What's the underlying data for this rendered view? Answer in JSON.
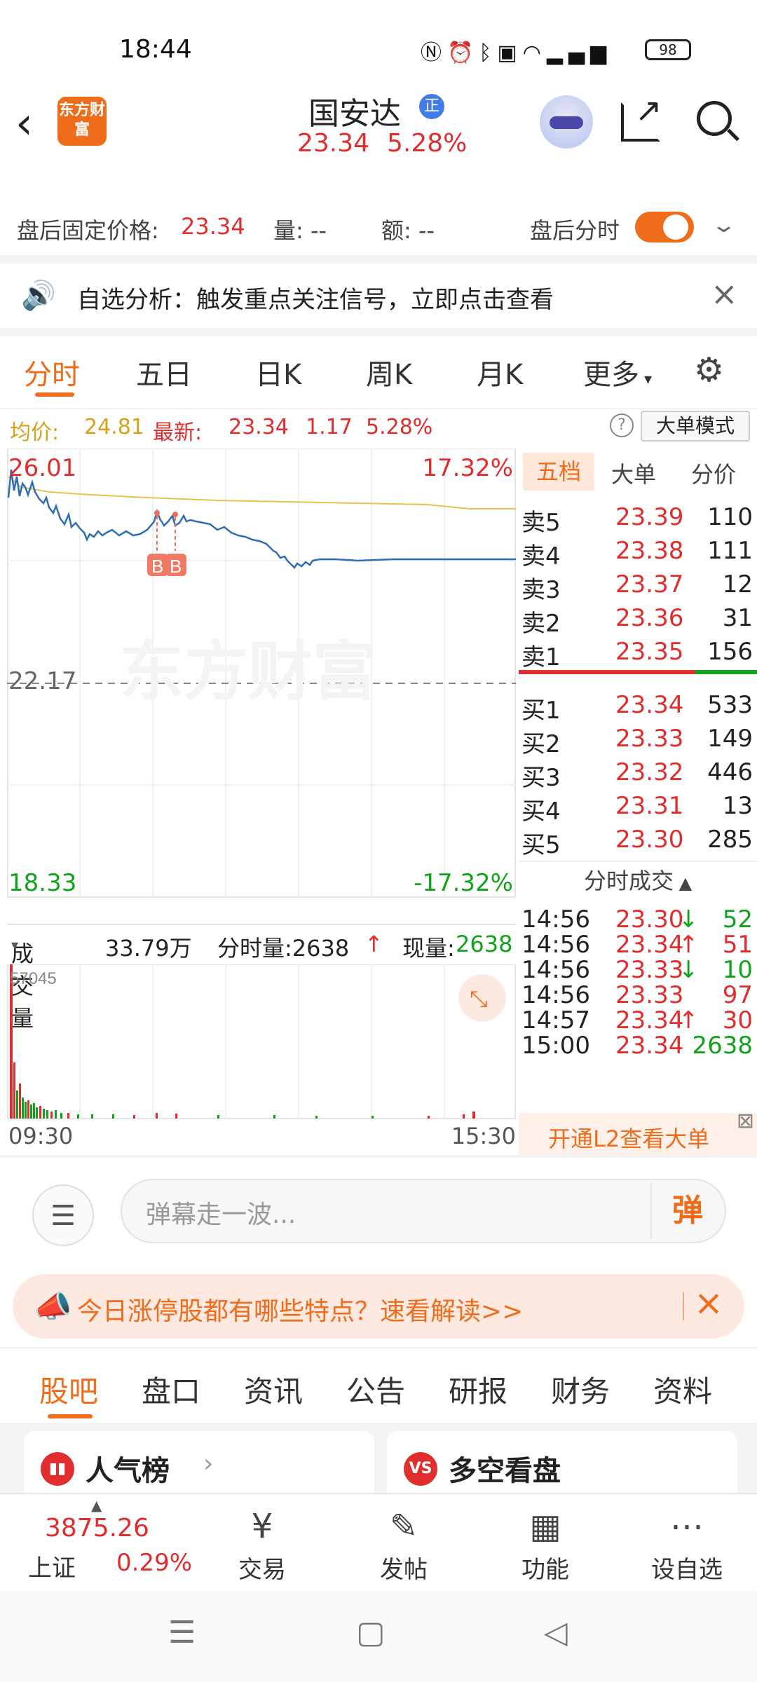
{
  "status_bar": {
    "time": "18:44",
    "icons": [
      "nfc-icon",
      "alarm-icon",
      "bluetooth-icon",
      "hd-icon",
      "wifi-icon",
      "signal-5g-icon"
    ],
    "battery": "98"
  },
  "header": {
    "logo_text": "东方财富",
    "stock_name": "国安达",
    "badge": "正",
    "price": "23.34",
    "change_pct": "5.28%"
  },
  "after_hours": {
    "label": "盘后固定价格:",
    "price": "23.34",
    "qty": "量: --",
    "amount": "额: --",
    "toggle_label": "盘后分时",
    "toggle_on": true
  },
  "alert": {
    "text": "自选分析：触发重点关注信号，立即点击查看"
  },
  "chart_tabs": [
    "分时",
    "五日",
    "日K",
    "周K",
    "月K",
    "更多"
  ],
  "avg_row": {
    "avg_label": "均价:",
    "avg_value": "24.81",
    "latest_label": "最新:",
    "latest_value": "23.34",
    "change": "1.17",
    "change_pct": "5.28%",
    "help": "?",
    "mode_button": "大单模式"
  },
  "chart_labels": {
    "max_price": "26.01",
    "max_pct": "17.32%",
    "prev_close": "22.17",
    "min_price": "18.33",
    "min_pct": "-17.32%",
    "marker_1": "B",
    "marker_2": "B",
    "watermark": "东方财富"
  },
  "volume": {
    "label": "成交量",
    "total": "33.79万",
    "minute_vol": "分时量:2638",
    "current_vol": "现量:",
    "current_vol_value": "2638",
    "max_tick": "57045"
  },
  "time_axis": {
    "start": "09:30",
    "end": "15:30"
  },
  "order_book": {
    "tabs": [
      "五档",
      "大单",
      "分价"
    ],
    "asks": [
      {
        "label": "卖5",
        "price": "23.39",
        "qty": "110"
      },
      {
        "label": "卖4",
        "price": "23.38",
        "qty": "111"
      },
      {
        "label": "卖3",
        "price": "23.37",
        "qty": "12"
      },
      {
        "label": "卖2",
        "price": "23.36",
        "qty": "31"
      },
      {
        "label": "卖1",
        "price": "23.35",
        "qty": "156"
      }
    ],
    "bids": [
      {
        "label": "买1",
        "price": "23.34",
        "qty": "533"
      },
      {
        "label": "买2",
        "price": "23.33",
        "qty": "149"
      },
      {
        "label": "买3",
        "price": "23.32",
        "qty": "446"
      },
      {
        "label": "买4",
        "price": "23.31",
        "qty": "13"
      },
      {
        "label": "买5",
        "price": "23.30",
        "qty": "285"
      }
    ],
    "ticks_title": "分时成交",
    "ticks": [
      {
        "time": "14:56",
        "price": "23.30",
        "arrow": "↓",
        "qty": "52",
        "dir": "down"
      },
      {
        "time": "14:56",
        "price": "23.34",
        "arrow": "↑",
        "qty": "51",
        "dir": "up"
      },
      {
        "time": "14:56",
        "price": "23.33",
        "arrow": "↓",
        "qty": "10",
        "dir": "down"
      },
      {
        "time": "14:56",
        "price": "23.33",
        "arrow": "",
        "qty": "97",
        "dir": "flat"
      },
      {
        "time": "14:57",
        "price": "23.34",
        "arrow": "↑",
        "qty": "30",
        "dir": "up"
      },
      {
        "time": "15:00",
        "price": "23.34",
        "arrow": "",
        "qty": "2638",
        "dir": "last"
      }
    ],
    "l2_banner": "开通L2查看大单"
  },
  "danmu": {
    "placeholder": "弹幕走一波...",
    "send": "弹"
  },
  "promo": {
    "text": "今日涨停股都有哪些特点？速看解读>>"
  },
  "bottom_tabs": [
    "股吧",
    "盘口",
    "资讯",
    "公告",
    "研报",
    "财务",
    "资料"
  ],
  "cards": [
    {
      "title": "人气榜",
      "icon": "popularity-icon"
    },
    {
      "title": "多空看盘",
      "icon": "vs-icon"
    }
  ],
  "bottom_nav": {
    "index_value": "3875.26",
    "index_name": "上证",
    "index_pct": "0.29%",
    "items": [
      "交易",
      "发帖",
      "功能",
      "设自选"
    ]
  },
  "colors": {
    "accent": "#ef6c1a",
    "up": "#e02d2d",
    "down": "#12a31c",
    "price_line": "#2f6db5",
    "avg_line": "#e8c24a"
  }
}
